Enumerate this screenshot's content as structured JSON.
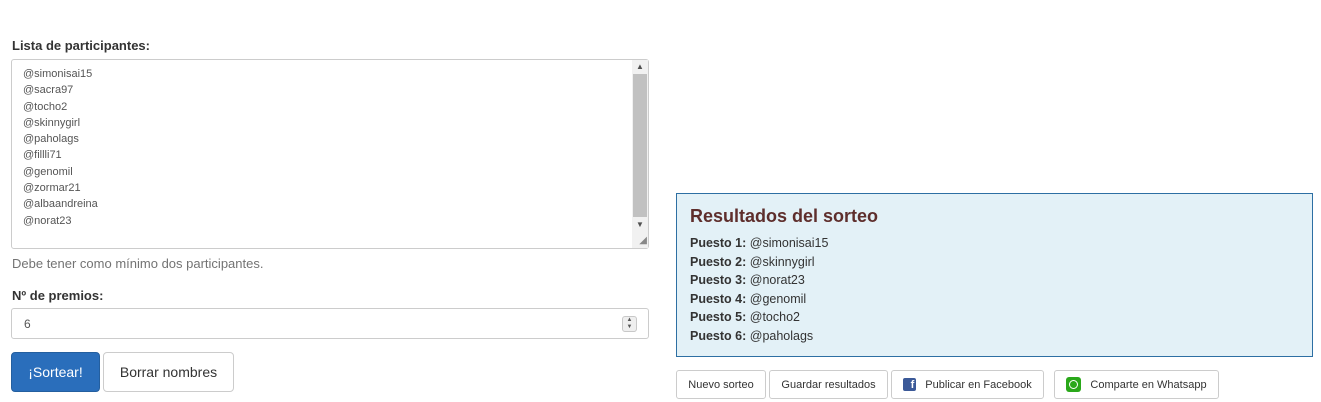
{
  "form": {
    "participants_label": "Lista de participantes:",
    "participants": [
      "@simonisai15",
      "@sacra97",
      "@tocho2",
      "@skinnygirl",
      "@paholags",
      "@fillli71",
      "@genomil",
      "@zormar21",
      "@albaandreina",
      "@norat23"
    ],
    "participants_help": "Debe tener como mínimo dos participantes.",
    "prizes_label": "Nº de premios:",
    "prizes_value": "6",
    "draw_button": "¡Sortear!",
    "clear_button": "Borrar nombres"
  },
  "results": {
    "title": "Resultados del sorteo",
    "places": [
      {
        "label": "Puesto 1:",
        "name": "@simonisai15"
      },
      {
        "label": "Puesto 2:",
        "name": "@skinnygirl"
      },
      {
        "label": "Puesto 3:",
        "name": "@norat23"
      },
      {
        "label": "Puesto 4:",
        "name": "@genomil"
      },
      {
        "label": "Puesto 5:",
        "name": "@tocho2"
      },
      {
        "label": "Puesto 6:",
        "name": "@paholags"
      }
    ]
  },
  "actions": {
    "new_draw": "Nuevo sorteo",
    "save_results": "Guardar resultados",
    "publish_facebook": "Publicar en Facebook",
    "share_whatsapp": "Comparte en Whatsapp"
  },
  "icons": {
    "facebook": "facebook-icon",
    "whatsapp": "whatsapp-icon"
  },
  "colors": {
    "primary": "#2a6ebb",
    "results_bg": "#e3f1f7",
    "results_border": "#2d6fa3",
    "results_title": "#5e2e2c",
    "facebook": "#3b5998",
    "whatsapp": "#2aa81a"
  }
}
